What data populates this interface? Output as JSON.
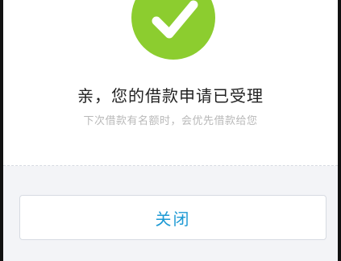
{
  "dialog": {
    "title": "亲，您的借款申请已受理",
    "subtitle": "下次借款有名额时，会优先借款给您",
    "close_label": "关闭"
  },
  "icons": {
    "success": "check-circle-icon"
  },
  "colors": {
    "success_green": "#8ccd2f",
    "button_text_blue": "#1e9ad4",
    "title_text": "#222222",
    "subtitle_text": "#b9b9b9",
    "bottom_background": "#f3f4f7"
  }
}
